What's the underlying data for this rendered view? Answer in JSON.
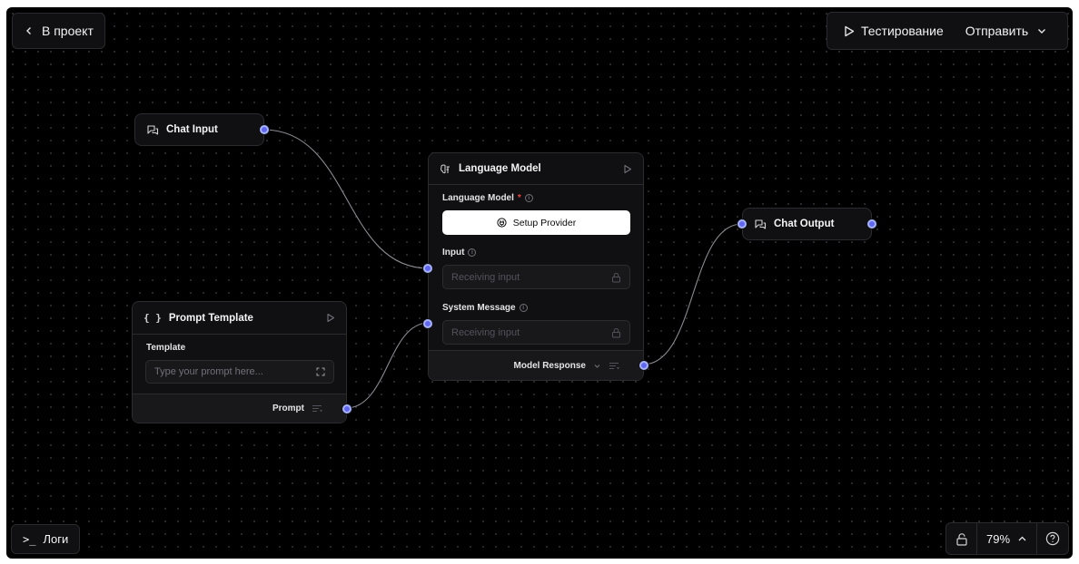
{
  "toolbar": {
    "back_label": "В проект",
    "test_label": "Тестирование",
    "send_label": "Отправить"
  },
  "bottom": {
    "logs_label": "Логи",
    "zoom_level": "79%"
  },
  "nodes": {
    "chat_input": {
      "title": "Chat Input"
    },
    "prompt_template": {
      "title": "Prompt Template",
      "field_label": "Template",
      "placeholder": "Type your prompt here...",
      "output_label": "Prompt"
    },
    "language_model": {
      "title": "Language Model",
      "model_label": "Language Model",
      "setup_button": "Setup Provider",
      "input_label": "Input",
      "input_placeholder": "Receiving input",
      "system_label": "System Message",
      "system_placeholder": "Receiving input",
      "output_label": "Model Response"
    },
    "chat_output": {
      "title": "Chat Output"
    }
  },
  "colors": {
    "canvas_bg": "#000000",
    "node_bg": "#101012",
    "handle": "#6366f1",
    "edge": "#8b8b92",
    "required": "#ef4444"
  },
  "icons": {
    "back": "chevron-left-icon",
    "play": "play-icon",
    "dropdown": "chevron-down-icon",
    "terminal": "terminal-icon",
    "lock": "lock-icon",
    "zoom_toggle": "chevron-up-icon",
    "help": "help-icon",
    "chat": "chat-bubble-icon",
    "braces": "braces-icon",
    "brain": "brain-icon",
    "expand": "expand-icon",
    "list": "list-icon"
  }
}
